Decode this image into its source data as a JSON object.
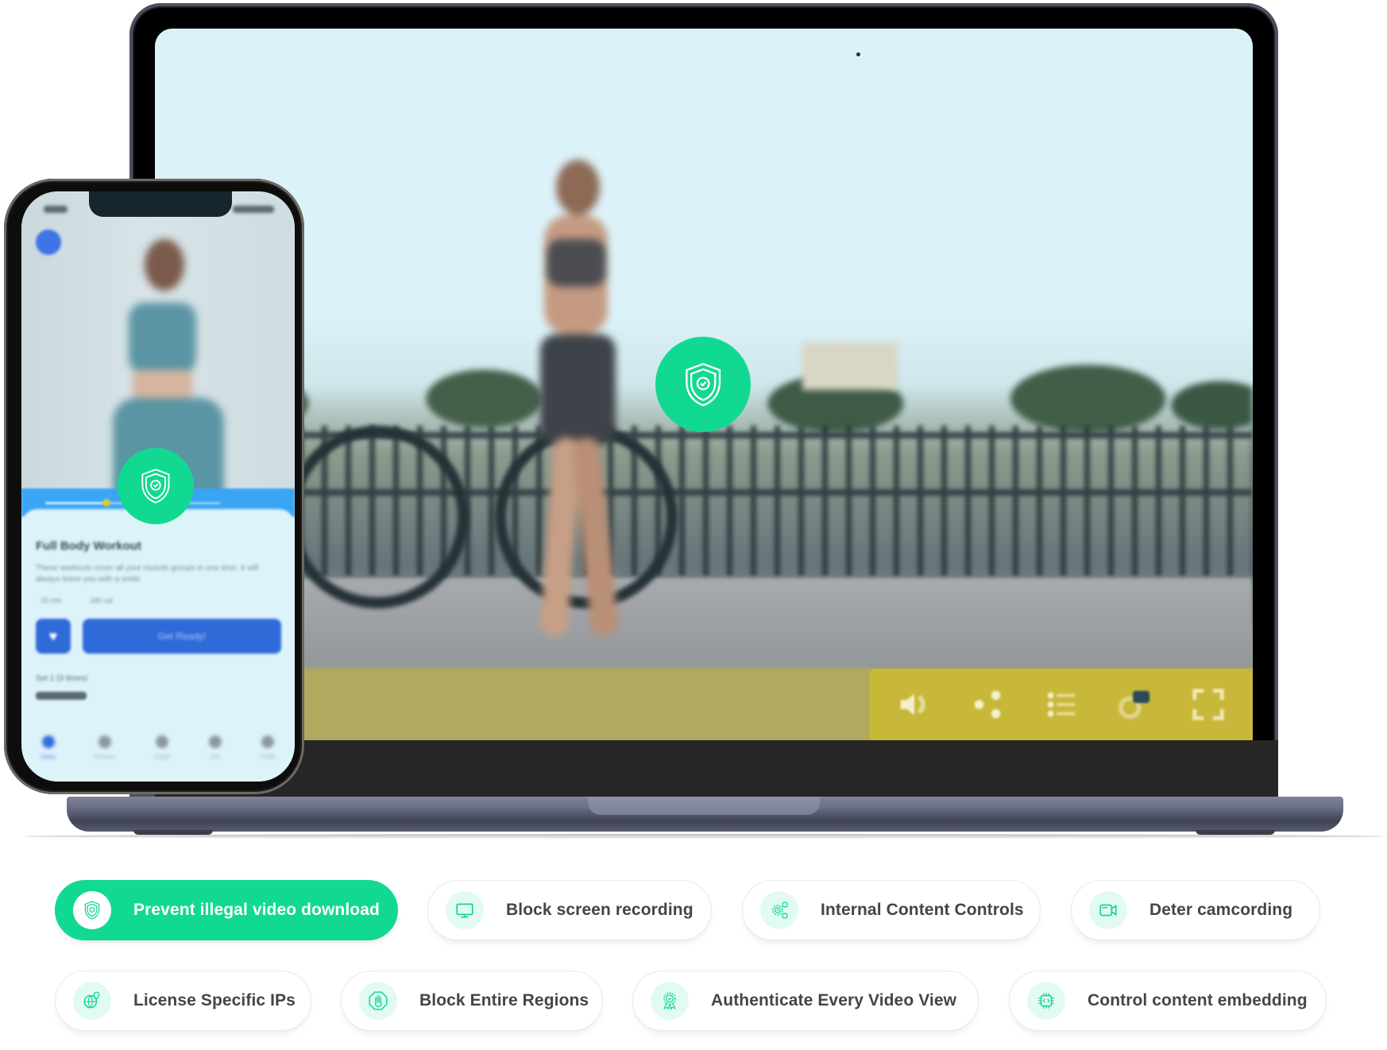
{
  "colors": {
    "accent_green": "#12d991",
    "icon_bg": "#e2fbf2",
    "control_bar": "#c8b83a",
    "phone_blue": "#2f6ad9",
    "pill_text": "#454545"
  },
  "laptop": {
    "player": {
      "protection_badge_icon": "shield-check-icon",
      "controls": [
        {
          "name": "volume",
          "icon": "speaker-icon"
        },
        {
          "name": "share",
          "icon": "share-icon"
        },
        {
          "name": "playlist",
          "icon": "list-icon"
        },
        {
          "name": "cast",
          "icon": "cast-icon"
        },
        {
          "name": "fullscreen",
          "icon": "fullscreen-icon"
        }
      ]
    }
  },
  "phone": {
    "player": {
      "progress": 0.35,
      "protection_badge_icon": "shield-check-icon"
    },
    "card": {
      "title": "Full Body Workout",
      "description": "These workouts cover all your muscle groups in one time. It will always leave you with a smile.",
      "chips": [
        "15 min",
        "180 cal"
      ],
      "favorite_icon": "heart-icon",
      "cta_label": "Get Ready!",
      "set_label": "Set 1 (3 times)"
    },
    "tabs": [
      {
        "label": "Home",
        "active": true
      },
      {
        "label": "Discover",
        "active": false
      },
      {
        "label": "Insight",
        "active": false
      },
      {
        "label": "Diet",
        "active": false
      },
      {
        "label": "Profile",
        "active": false
      }
    ]
  },
  "features": [
    {
      "label": "Prevent illegal video download",
      "icon": "shield-check-icon",
      "active": true
    },
    {
      "label": "Block screen recording",
      "icon": "monitor-icon",
      "active": false
    },
    {
      "label": "Internal Content Controls",
      "icon": "gear-play-icon",
      "active": false
    },
    {
      "label": "Deter camcording",
      "icon": "video-camera-icon",
      "active": false
    },
    {
      "label": "License Specific IPs",
      "icon": "globe-pin-icon",
      "active": false
    },
    {
      "label": "Block Entire Regions",
      "icon": "stop-hand-icon",
      "active": false
    },
    {
      "label": "Authenticate Every Video View",
      "icon": "badge-check-icon",
      "active": false
    },
    {
      "label": "Control content embedding",
      "icon": "chip-code-icon",
      "active": false
    }
  ]
}
